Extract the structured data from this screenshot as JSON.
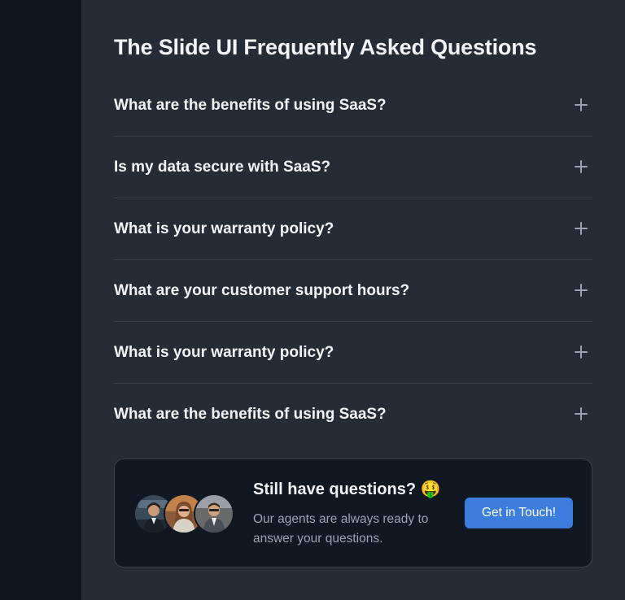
{
  "faq": {
    "title": "The Slide UI Frequently Asked Questions",
    "items": [
      {
        "question": "What are the benefits of using SaaS?"
      },
      {
        "question": "Is my data secure with SaaS?"
      },
      {
        "question": "What is your warranty policy?"
      },
      {
        "question": "What are your customer support hours?"
      },
      {
        "question": "What is your warranty policy?"
      },
      {
        "question": "What are the benefits of using SaaS?"
      }
    ],
    "expand_icon": "plus-icon"
  },
  "contact": {
    "title": "Still have questions? 🤑",
    "description": "Our agents are always ready to answer your questions.",
    "button_label": "Get in Touch!",
    "avatars": [
      "agent-avatar-1",
      "agent-avatar-2",
      "agent-avatar-3"
    ]
  },
  "colors": {
    "page_background": "#262c35",
    "side_rail": "#0e141e",
    "card_background": "#111822",
    "accent": "#3b7ddd",
    "heading_text": "#f3f4f6",
    "muted_text": "#9ca3af",
    "divider": "#3b424c"
  }
}
